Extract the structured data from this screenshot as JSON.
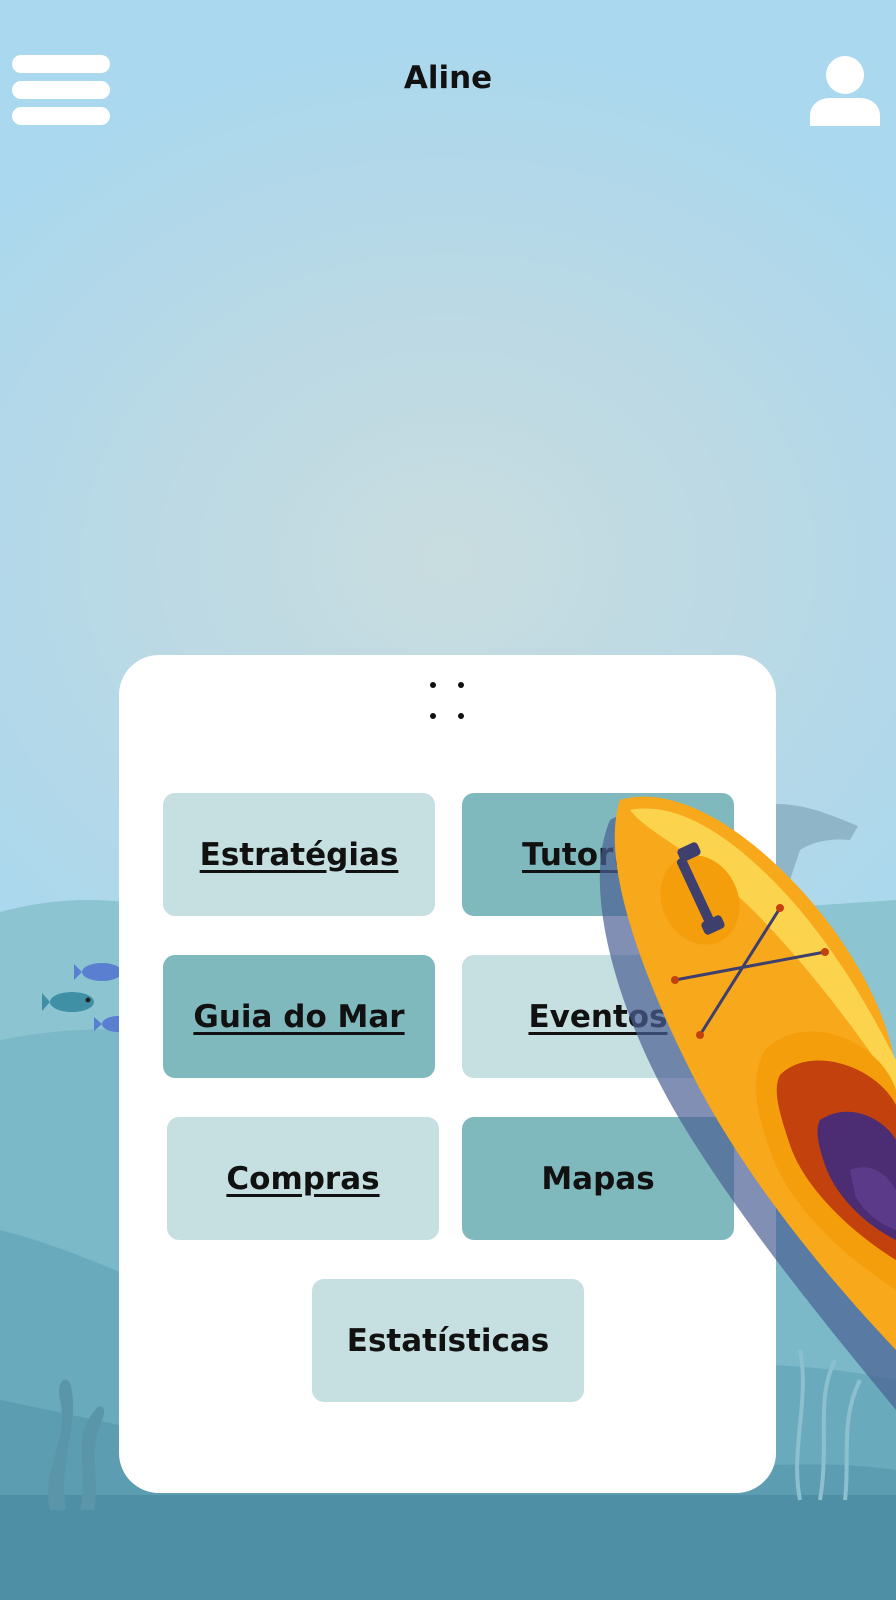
{
  "header": {
    "title": "Aline",
    "menu_icon": "hamburger-menu-icon",
    "profile_icon": "user-profile-icon"
  },
  "menu": {
    "items": [
      {
        "label": "Estratégias",
        "style": "light",
        "underlined": true
      },
      {
        "label": "Tutoriais",
        "style": "dark",
        "underlined": true
      },
      {
        "label": "Guia do Mar",
        "style": "dark",
        "underlined": true
      },
      {
        "label": "Eventos",
        "style": "light",
        "underlined": true
      },
      {
        "label": "Compras",
        "style": "light",
        "underlined": true
      },
      {
        "label": "Mapas",
        "style": "dark",
        "underlined": false
      },
      {
        "label": "Estatísticas",
        "style": "light",
        "underlined": false
      }
    ]
  },
  "colors": {
    "sky": "#aad8ee",
    "sea_light": "#88c3cf",
    "sea_mid": "#6aaabb",
    "sea_deep": "#4f8fa5",
    "tile_light": "#c6e0e2",
    "tile_dark": "#7fb9bd",
    "kayak_orange": "#f7a81b"
  }
}
